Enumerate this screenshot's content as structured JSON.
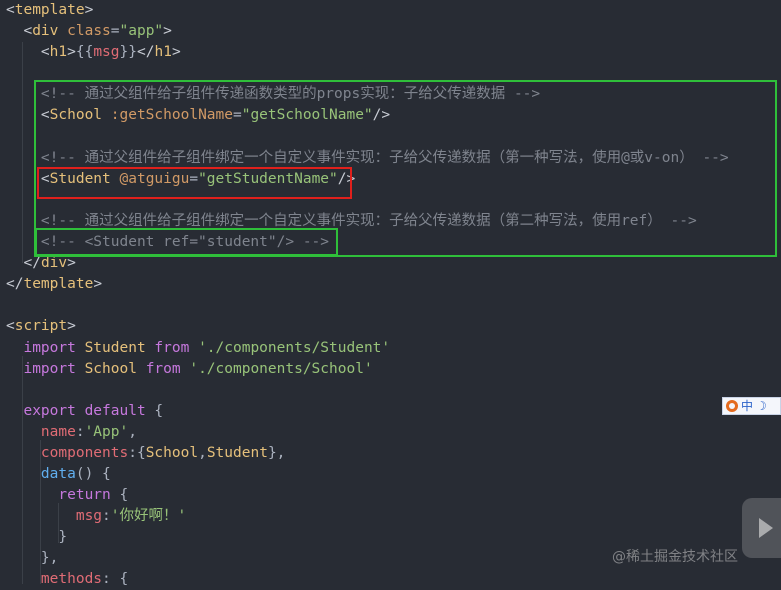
{
  "code_lines": [
    [
      {
        "c": "bracket",
        "t": "<"
      },
      {
        "c": "tag",
        "t": "template"
      },
      {
        "c": "bracket",
        "t": ">"
      }
    ],
    [
      {
        "c": "plain",
        "t": "  "
      },
      {
        "c": "bracket",
        "t": "<"
      },
      {
        "c": "tag",
        "t": "div "
      },
      {
        "c": "attr",
        "t": "class"
      },
      {
        "c": "plain",
        "t": "="
      },
      {
        "c": "str",
        "t": "\"app\""
      },
      {
        "c": "bracket",
        "t": ">"
      }
    ],
    [
      {
        "c": "plain",
        "t": "    "
      },
      {
        "c": "bracket",
        "t": "<"
      },
      {
        "c": "tag",
        "t": "h1"
      },
      {
        "c": "bracket",
        "t": ">"
      },
      {
        "c": "plain",
        "t": "{{"
      },
      {
        "c": "prop",
        "t": "msg"
      },
      {
        "c": "plain",
        "t": "}}"
      },
      {
        "c": "bracket",
        "t": "</"
      },
      {
        "c": "tag",
        "t": "h1"
      },
      {
        "c": "bracket",
        "t": ">"
      }
    ],
    [],
    [
      {
        "c": "plain",
        "t": "    "
      },
      {
        "c": "cmt",
        "t": "<!-- 通过父组件给子组件传递函数类型的props实现：子给父传递数据 -->"
      }
    ],
    [
      {
        "c": "plain",
        "t": "    "
      },
      {
        "c": "bracket",
        "t": "<"
      },
      {
        "c": "tag",
        "t": "School "
      },
      {
        "c": "attr",
        "t": ":getSchoolName"
      },
      {
        "c": "plain",
        "t": "="
      },
      {
        "c": "str",
        "t": "\"getSchoolName\""
      },
      {
        "c": "bracket",
        "t": "/>"
      }
    ],
    [],
    [
      {
        "c": "plain",
        "t": "    "
      },
      {
        "c": "cmt",
        "t": "<!-- 通过父组件给子组件绑定一个自定义事件实现：子给父传递数据（第一种写法，使用@或v-on） -->"
      }
    ],
    [
      {
        "c": "plain",
        "t": "    "
      },
      {
        "c": "bracket",
        "t": "<"
      },
      {
        "c": "tag",
        "t": "Student "
      },
      {
        "c": "attr",
        "t": "@atguigu"
      },
      {
        "c": "plain",
        "t": "="
      },
      {
        "c": "str",
        "t": "\"getStudentName\""
      },
      {
        "c": "bracket",
        "t": "/>"
      }
    ],
    [],
    [
      {
        "c": "plain",
        "t": "    "
      },
      {
        "c": "cmt",
        "t": "<!-- 通过父组件给子组件绑定一个自定义事件实现：子给父传递数据（第二种写法，使用ref） -->"
      }
    ],
    [
      {
        "c": "plain",
        "t": "    "
      },
      {
        "c": "cmt",
        "t": "<!-- <Student ref=\"student\"/> -->"
      }
    ],
    [
      {
        "c": "plain",
        "t": "  "
      },
      {
        "c": "bracket",
        "t": "</"
      },
      {
        "c": "tag",
        "t": "div"
      },
      {
        "c": "bracket",
        "t": ">"
      }
    ],
    [
      {
        "c": "bracket",
        "t": "</"
      },
      {
        "c": "tag",
        "t": "template"
      },
      {
        "c": "bracket",
        "t": ">"
      }
    ],
    [],
    [
      {
        "c": "bracket",
        "t": "<"
      },
      {
        "c": "tag",
        "t": "script"
      },
      {
        "c": "bracket",
        "t": ">"
      }
    ],
    [
      {
        "c": "plain",
        "t": "  "
      },
      {
        "c": "kw",
        "t": "import "
      },
      {
        "c": "tag",
        "t": "Student "
      },
      {
        "c": "kw",
        "t": "from "
      },
      {
        "c": "str",
        "t": "'./components/Student'"
      }
    ],
    [
      {
        "c": "plain",
        "t": "  "
      },
      {
        "c": "kw",
        "t": "import "
      },
      {
        "c": "tag",
        "t": "School "
      },
      {
        "c": "kw",
        "t": "from "
      },
      {
        "c": "str",
        "t": "'./components/School'"
      }
    ],
    [],
    [
      {
        "c": "plain",
        "t": "  "
      },
      {
        "c": "kw",
        "t": "export default "
      },
      {
        "c": "plain",
        "t": "{"
      }
    ],
    [
      {
        "c": "plain",
        "t": "    "
      },
      {
        "c": "prop",
        "t": "name"
      },
      {
        "c": "plain",
        "t": ":"
      },
      {
        "c": "str",
        "t": "'App'"
      },
      {
        "c": "plain",
        "t": ","
      }
    ],
    [
      {
        "c": "plain",
        "t": "    "
      },
      {
        "c": "prop",
        "t": "components"
      },
      {
        "c": "plain",
        "t": ":{"
      },
      {
        "c": "tag",
        "t": "School"
      },
      {
        "c": "plain",
        "t": ","
      },
      {
        "c": "tag",
        "t": "Student"
      },
      {
        "c": "plain",
        "t": "},"
      }
    ],
    [
      {
        "c": "plain",
        "t": "    "
      },
      {
        "c": "fn",
        "t": "data"
      },
      {
        "c": "plain",
        "t": "() {"
      }
    ],
    [
      {
        "c": "plain",
        "t": "      "
      },
      {
        "c": "kw",
        "t": "return "
      },
      {
        "c": "plain",
        "t": "{"
      }
    ],
    [
      {
        "c": "plain",
        "t": "        "
      },
      {
        "c": "prop",
        "t": "msg"
      },
      {
        "c": "plain",
        "t": ":"
      },
      {
        "c": "str",
        "t": "'你好啊！'"
      }
    ],
    [
      {
        "c": "plain",
        "t": "      "
      },
      {
        "c": "plain",
        "t": "}"
      }
    ],
    [
      {
        "c": "plain",
        "t": "    "
      },
      {
        "c": "plain",
        "t": "},"
      }
    ],
    [
      {
        "c": "plain",
        "t": "    "
      },
      {
        "c": "prop",
        "t": "methods"
      },
      {
        "c": "plain",
        "t": ": {"
      }
    ]
  ],
  "highlights": {
    "outer_box_color": "#2fbf3a",
    "student_box_color": "#e0201c",
    "ref_box_color": "#2fbf3a"
  },
  "ime": {
    "label": "中"
  },
  "watermark": "@稀土掘金技术社区"
}
